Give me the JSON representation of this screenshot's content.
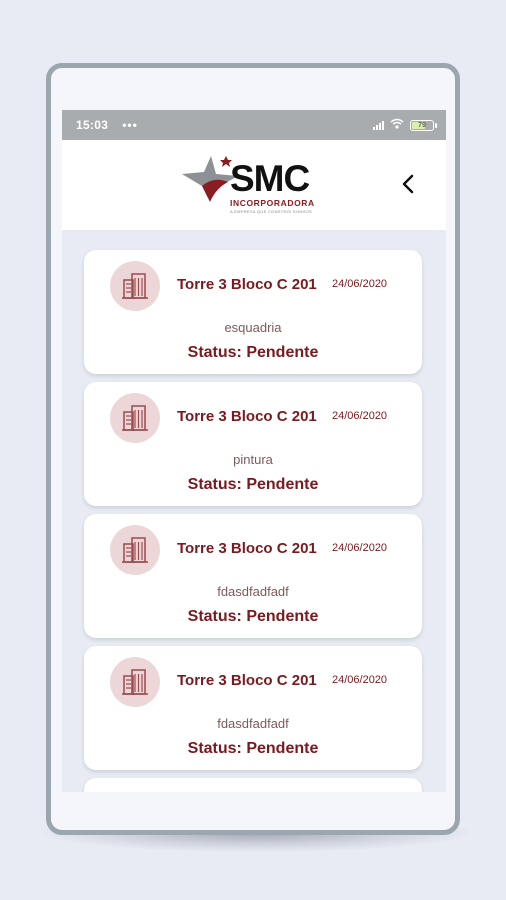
{
  "status_bar": {
    "time": "15:03",
    "dots": "•••",
    "battery": "79"
  },
  "header": {
    "brand": "SMC",
    "tagline": "INCORPORADORA",
    "tiny_text": "A EMPRESA QUE CONSTRÓI SONHOS",
    "back_icon": "chevron-left-icon"
  },
  "colors": {
    "accent": "#7a1a1f",
    "avatar_bg": "#edd6d7",
    "background": "#e8ebf4"
  },
  "items": [
    {
      "unit": "Torre 3 Bloco C 201",
      "date": "24/06/2020",
      "description": "esquadria",
      "status": "Status: Pendente"
    },
    {
      "unit": "Torre 3 Bloco C 201",
      "date": "24/06/2020",
      "description": "pintura",
      "status": "Status: Pendente"
    },
    {
      "unit": "Torre 3 Bloco C 201",
      "date": "24/06/2020",
      "description": "fdasdfadfadf",
      "status": "Status: Pendente"
    },
    {
      "unit": "Torre 3 Bloco C 201",
      "date": "24/06/2020",
      "description": "fdasdfadfadf",
      "status": "Status: Pendente"
    }
  ]
}
